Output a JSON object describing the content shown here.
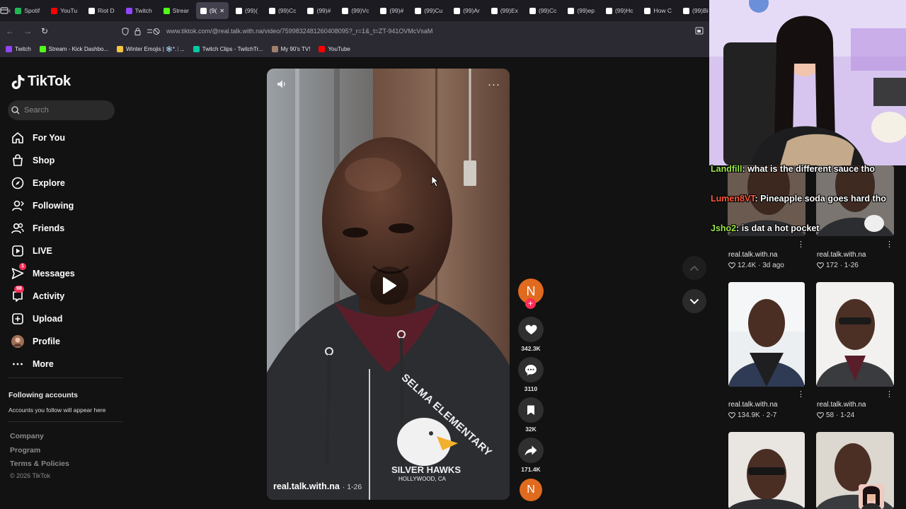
{
  "browser": {
    "tabs": [
      {
        "label": "Spotif",
        "color": "#1db954"
      },
      {
        "label": "YouTu",
        "color": "#ff0000"
      },
      {
        "label": "Riot D",
        "color": "#ffffff"
      },
      {
        "label": "Twitch",
        "color": "#9146ff"
      },
      {
        "label": "Strear",
        "color": "#53fc18"
      },
      {
        "label": "(9(",
        "color": "#ffffff"
      },
      {
        "label": "(99)(",
        "color": "#ffffff"
      },
      {
        "label": "(99)Cc",
        "color": "#ffffff"
      },
      {
        "label": "(99)#",
        "color": "#ffffff"
      },
      {
        "label": "(99)Vc",
        "color": "#ffffff"
      },
      {
        "label": "(99)#",
        "color": "#ffffff"
      },
      {
        "label": "(99)Cu",
        "color": "#ffffff"
      },
      {
        "label": "(99)Ar",
        "color": "#ffffff"
      },
      {
        "label": "(99)Ex",
        "color": "#ffffff"
      },
      {
        "label": "(99)Cc",
        "color": "#ffffff"
      },
      {
        "label": "(99)ep",
        "color": "#ffffff"
      },
      {
        "label": "(99)Hc",
        "color": "#ffffff"
      },
      {
        "label": "How C",
        "color": "#ffffff"
      },
      {
        "label": "(99)Bi",
        "color": "#ffffff"
      }
    ],
    "url": "www.tiktok.com/@real.talk.with.na/video/7599832481260408095?_r=1&_t=ZT-941OVMcVsaM",
    "bookmarks": [
      {
        "label": "Twitch",
        "color": "#9146ff"
      },
      {
        "label": "Stream - Kick Dashbo...",
        "color": "#53fc18"
      },
      {
        "label": "Winter Emojis | ❄️*.ᛁ...",
        "color": "#f5c542"
      },
      {
        "label": "Twitch Clips - TwitchTr...",
        "color": "#00c8a0"
      },
      {
        "label": "My 90's TV!",
        "color": "#a0806a"
      },
      {
        "label": "YouTube",
        "color": "#ff0000"
      }
    ]
  },
  "sidebar": {
    "logo": "TikTok",
    "search_placeholder": "Search",
    "nav": [
      {
        "label": "For You",
        "icon": "home-icon"
      },
      {
        "label": "Shop",
        "icon": "shop-icon"
      },
      {
        "label": "Explore",
        "icon": "compass-icon"
      },
      {
        "label": "Following",
        "icon": "following-icon"
      },
      {
        "label": "Friends",
        "icon": "friends-icon"
      },
      {
        "label": "LIVE",
        "icon": "live-icon"
      },
      {
        "label": "Messages",
        "icon": "messages-icon",
        "badge": "1"
      },
      {
        "label": "Activity",
        "icon": "activity-icon",
        "badge": "98"
      },
      {
        "label": "Upload",
        "icon": "upload-icon"
      },
      {
        "label": "Profile",
        "icon": "avatar"
      },
      {
        "label": "More",
        "icon": "more-icon"
      }
    ],
    "following_title": "Following accounts",
    "following_desc": "Accounts you follow will appear here",
    "footer": [
      "Company",
      "Program",
      "Terms & Policies"
    ],
    "copyright": "© 2026 TikTok"
  },
  "video": {
    "author": "real.talk.with.na",
    "date": "· 1-26",
    "hoodie_line1": "SELMA ELEMENTARY",
    "hoodie_line2": "SILVER HAWKS",
    "hoodie_line3": "HOLLYWOOD, CA"
  },
  "actions": {
    "avatar_letter": "N",
    "likes": "342.3K",
    "comments": "3110",
    "saves": "32K",
    "shares": "171.4K"
  },
  "grid": [
    {
      "user": "real.talk.with.na",
      "likes": "12.4K",
      "date": "· 3d ago"
    },
    {
      "user": "real.talk.with.na",
      "likes": "172",
      "date": "· 1-26"
    },
    {
      "user": "real.talk.with.na",
      "likes": "134.9K",
      "date": "· 2-7"
    },
    {
      "user": "real.talk.with.na",
      "likes": "58",
      "date": "· 1-24"
    }
  ],
  "chat": [
    {
      "name": "Landfill",
      "color": "#9be64a",
      "msg": ": what is the different sauce tho"
    },
    {
      "name": "Lumen8VT",
      "color": "#ff5a3c",
      "msg": ": Pineapple soda goes hard tho"
    },
    {
      "name": "Jsho2",
      "color": "#9be64a",
      "msg": ": is dat a hot pocket"
    }
  ]
}
